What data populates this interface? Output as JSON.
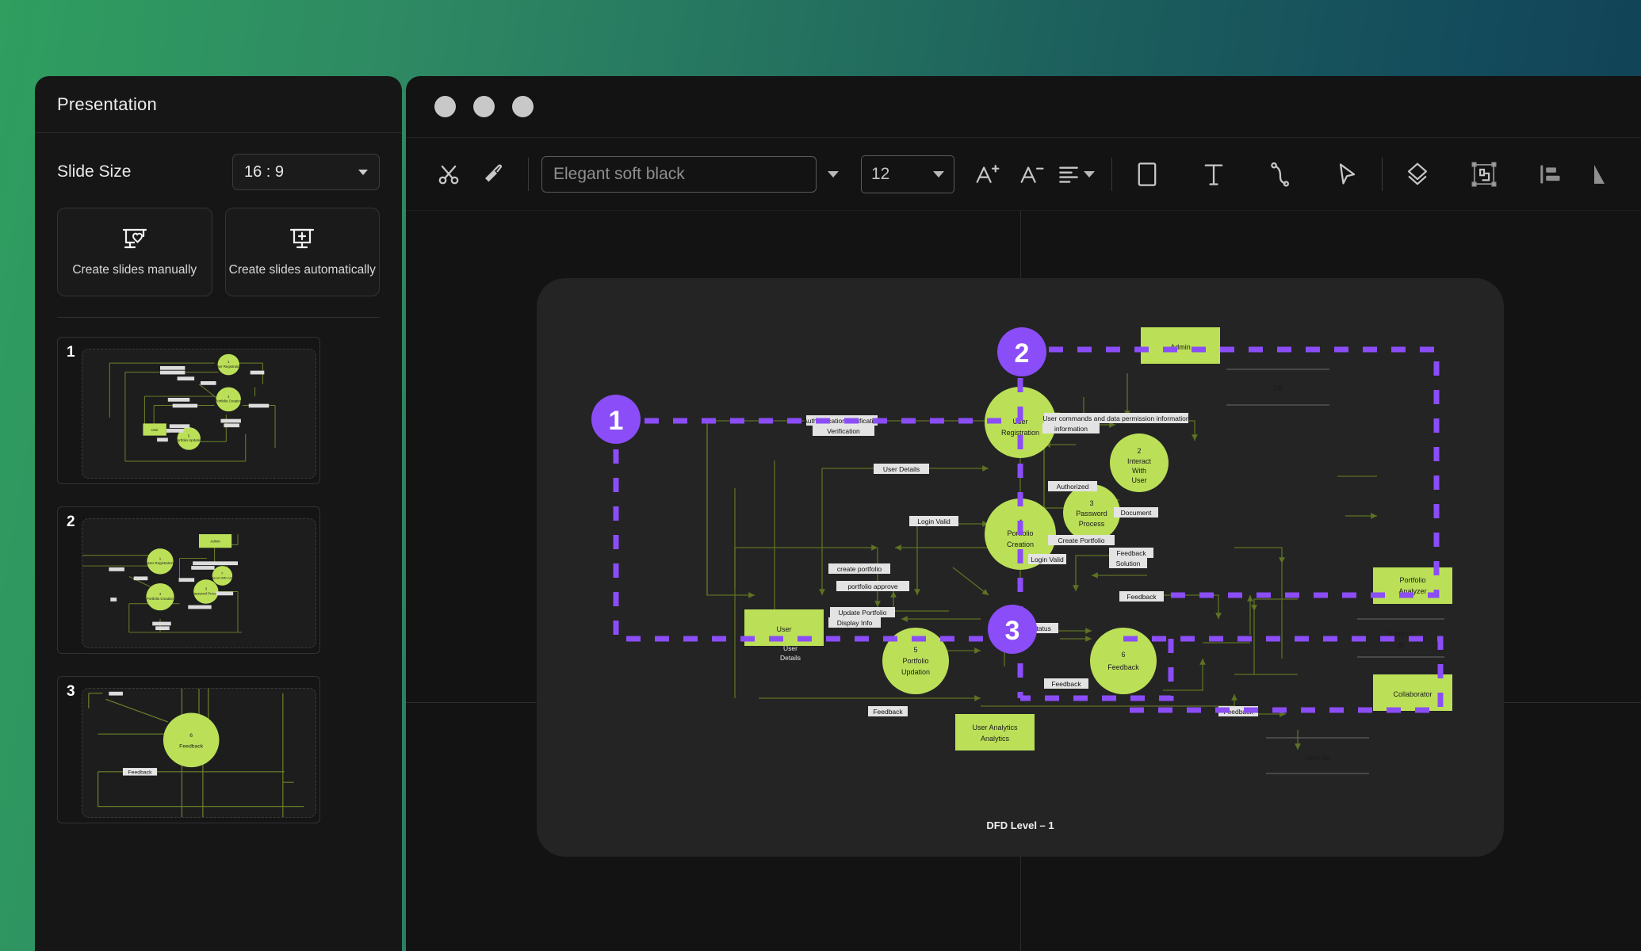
{
  "background": {
    "gradient_from": "#2f9e5f",
    "gradient_to": "#123c52"
  },
  "left_panel": {
    "title": "Presentation",
    "slide_size": {
      "label": "Slide Size",
      "value": "16 : 9"
    },
    "create_cards": [
      {
        "icon": "slide-manual-icon",
        "label": "Create slides manually"
      },
      {
        "icon": "slide-auto-icon",
        "label": "Create slides automatically"
      }
    ],
    "thumbnails": [
      {
        "number": "1"
      },
      {
        "number": "2"
      },
      {
        "number": "3"
      }
    ]
  },
  "editor": {
    "window_controls": [
      "close",
      "minimize",
      "maximize"
    ],
    "toolbar": {
      "cut_label": "cut-icon",
      "brush_label": "paint-brush-icon",
      "font_name": {
        "value": "",
        "placeholder": "Elegant soft black"
      },
      "font_size": {
        "value": "12"
      },
      "increase_font": "A+",
      "decrease_font": "A-",
      "items": [
        "cut-icon",
        "paint-brush-icon",
        "font-name-input",
        "font-name-caret",
        "font-size-select",
        "increase-font-icon",
        "decrease-font-icon",
        "align-text-icon",
        "rectangle-shape-icon",
        "text-tool-icon",
        "connector-tool-icon",
        "pointer-tool-icon",
        "layers-icon",
        "group-frame-icon",
        "align-left-icon",
        "shape-tool-icon"
      ]
    }
  },
  "chart_data": {
    "type": "diagram",
    "title": "DFD Level – 1",
    "processes": [
      {
        "id": "1",
        "name": "User Registration"
      },
      {
        "id": "2",
        "name": "Interact With User"
      },
      {
        "id": "3",
        "name": "Password Process"
      },
      {
        "id": "4",
        "name": "Portfolio Creation"
      },
      {
        "id": "5",
        "name": "Portfolio Updation"
      },
      {
        "id": "6",
        "name": "Feedback"
      }
    ],
    "entities": [
      "Admin",
      "User",
      "User Analytics",
      "Portfolio Analyzer",
      "Collaborator"
    ],
    "data_stores": [
      "DB",
      "User db",
      "Portfolio db"
    ],
    "flows": [
      "Authentication Verification",
      "User Details",
      "Login  Valid",
      "create portfolio",
      "portfolio approve",
      "Update Portfolio",
      "Display Info",
      "User Details",
      "User commands and data permission information",
      "Authorized",
      "Document",
      "Create Portfolio",
      "Feedback Solution",
      "Feedback",
      "Portfolio Status",
      "Login  Valid"
    ],
    "annotations": [
      {
        "number": "1"
      },
      {
        "number": "2"
      },
      {
        "number": "3"
      }
    ],
    "colors": {
      "node": "#bbe058",
      "flow": "#5d7223",
      "annotation": "#8b4df7",
      "canvas": "#242424"
    }
  }
}
